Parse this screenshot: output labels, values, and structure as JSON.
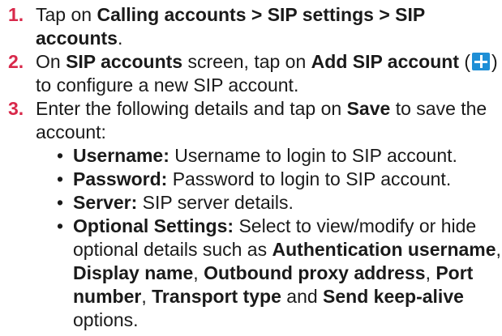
{
  "steps": [
    {
      "number": "1.",
      "pre": "Tap on ",
      "bold_path": "Calling accounts > SIP settings > SIP accounts",
      "post": "."
    },
    {
      "number": "2.",
      "pre": "On ",
      "bold_screen": "SIP accounts",
      "mid": " screen, tap on ",
      "bold_action": "Add SIP account",
      "open_paren": " (",
      "icon": "plus-icon",
      "close_paren": ")",
      "post": " to configure a new SIP account."
    },
    {
      "number": "3.",
      "pre": "Enter the following details and tap on ",
      "bold_action": "Save",
      "post": " to save the account:"
    }
  ],
  "details": [
    {
      "label": "Username:",
      "text": " Username to login to SIP account."
    },
    {
      "label": "Password:",
      "text": " Password to login to SIP account."
    },
    {
      "label": "Server:",
      "text": " SIP server details."
    }
  ],
  "optional": {
    "label": "Optional Settings:",
    "text": " Select to view/modify or hide optional details such as ",
    "items": [
      "Authentication username",
      "Display name",
      "Outbound proxy address",
      "Port number",
      "Transport type"
    ],
    "sep": ", ",
    "and": " and ",
    "last": "Send keep-alive",
    "tail": " options."
  },
  "bullet": "•",
  "colors": {
    "step_number": "#d8284a",
    "icon": "#1f8fd6",
    "text": "#1a1a1a"
  }
}
